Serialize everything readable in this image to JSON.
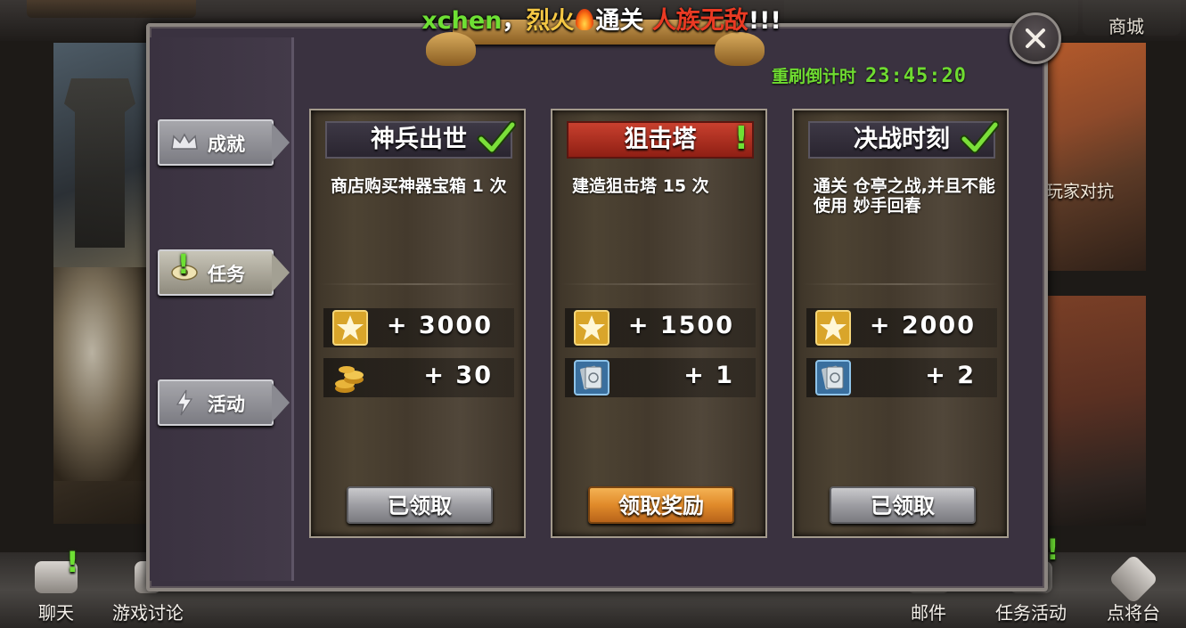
{
  "banner": {
    "player": "xchen",
    "sep": "，",
    "adjective": "烈火",
    "action": "通关",
    "stage": "人族无敌",
    "suffix": "!!!"
  },
  "background": {
    "shop_label": "商城",
    "right_panel_label": "玩家对抗"
  },
  "modal": {
    "countdown_label": "重刷倒计时",
    "countdown_time": "23:45:20",
    "close_icon": "close-icon"
  },
  "sidebar": {
    "tabs": [
      {
        "label": "成就",
        "icon": "crown-icon",
        "active": false
      },
      {
        "label": "任务",
        "icon": "eye-icon",
        "active": true,
        "alert": "!"
      },
      {
        "label": "活动",
        "icon": "lightning-icon",
        "active": false
      }
    ]
  },
  "quests": [
    {
      "title": "神兵出世",
      "status_icon": "check-icon",
      "description": "商店购买神器宝箱 1 次",
      "rewards": [
        {
          "icon": "star-icon",
          "text": "+ 3000"
        },
        {
          "icon": "gold-coins-icon",
          "text": "+ 30"
        }
      ],
      "button": "已领取",
      "button_state": "claimed"
    },
    {
      "title": "狙击塔",
      "status_icon": "alert",
      "status_text": "!",
      "description": "建造狙击塔 15 次",
      "rewards": [
        {
          "icon": "star-icon",
          "text": "+ 1500"
        },
        {
          "icon": "card-icon",
          "text": "+ 1"
        }
      ],
      "button": "领取奖励",
      "button_state": "claimable"
    },
    {
      "title": "决战时刻",
      "status_icon": "check-icon",
      "description": "通关 仓亭之战,并且不能使用 妙手回春",
      "rewards": [
        {
          "icon": "star-icon",
          "text": "+ 2000"
        },
        {
          "icon": "card-icon",
          "text": "+ 2"
        }
      ],
      "button": "已领取",
      "button_state": "claimed"
    }
  ],
  "bottom_bar": {
    "items": [
      {
        "label": "聊天",
        "icon": "chat-icon",
        "alert": "!"
      },
      {
        "label": "游戏讨论",
        "icon": "discussion-icon"
      },
      {
        "label": "邮件",
        "icon": "mail-icon"
      },
      {
        "label": "任务活动",
        "icon": "quest-icon",
        "alert": "!"
      },
      {
        "label": "点将台",
        "icon": "general-icon"
      }
    ]
  },
  "colors": {
    "alert_green": "#6ee034",
    "banner_gold": "#f4c744",
    "banner_red": "#ea3a23",
    "claim_orange": "#e08a2a"
  }
}
